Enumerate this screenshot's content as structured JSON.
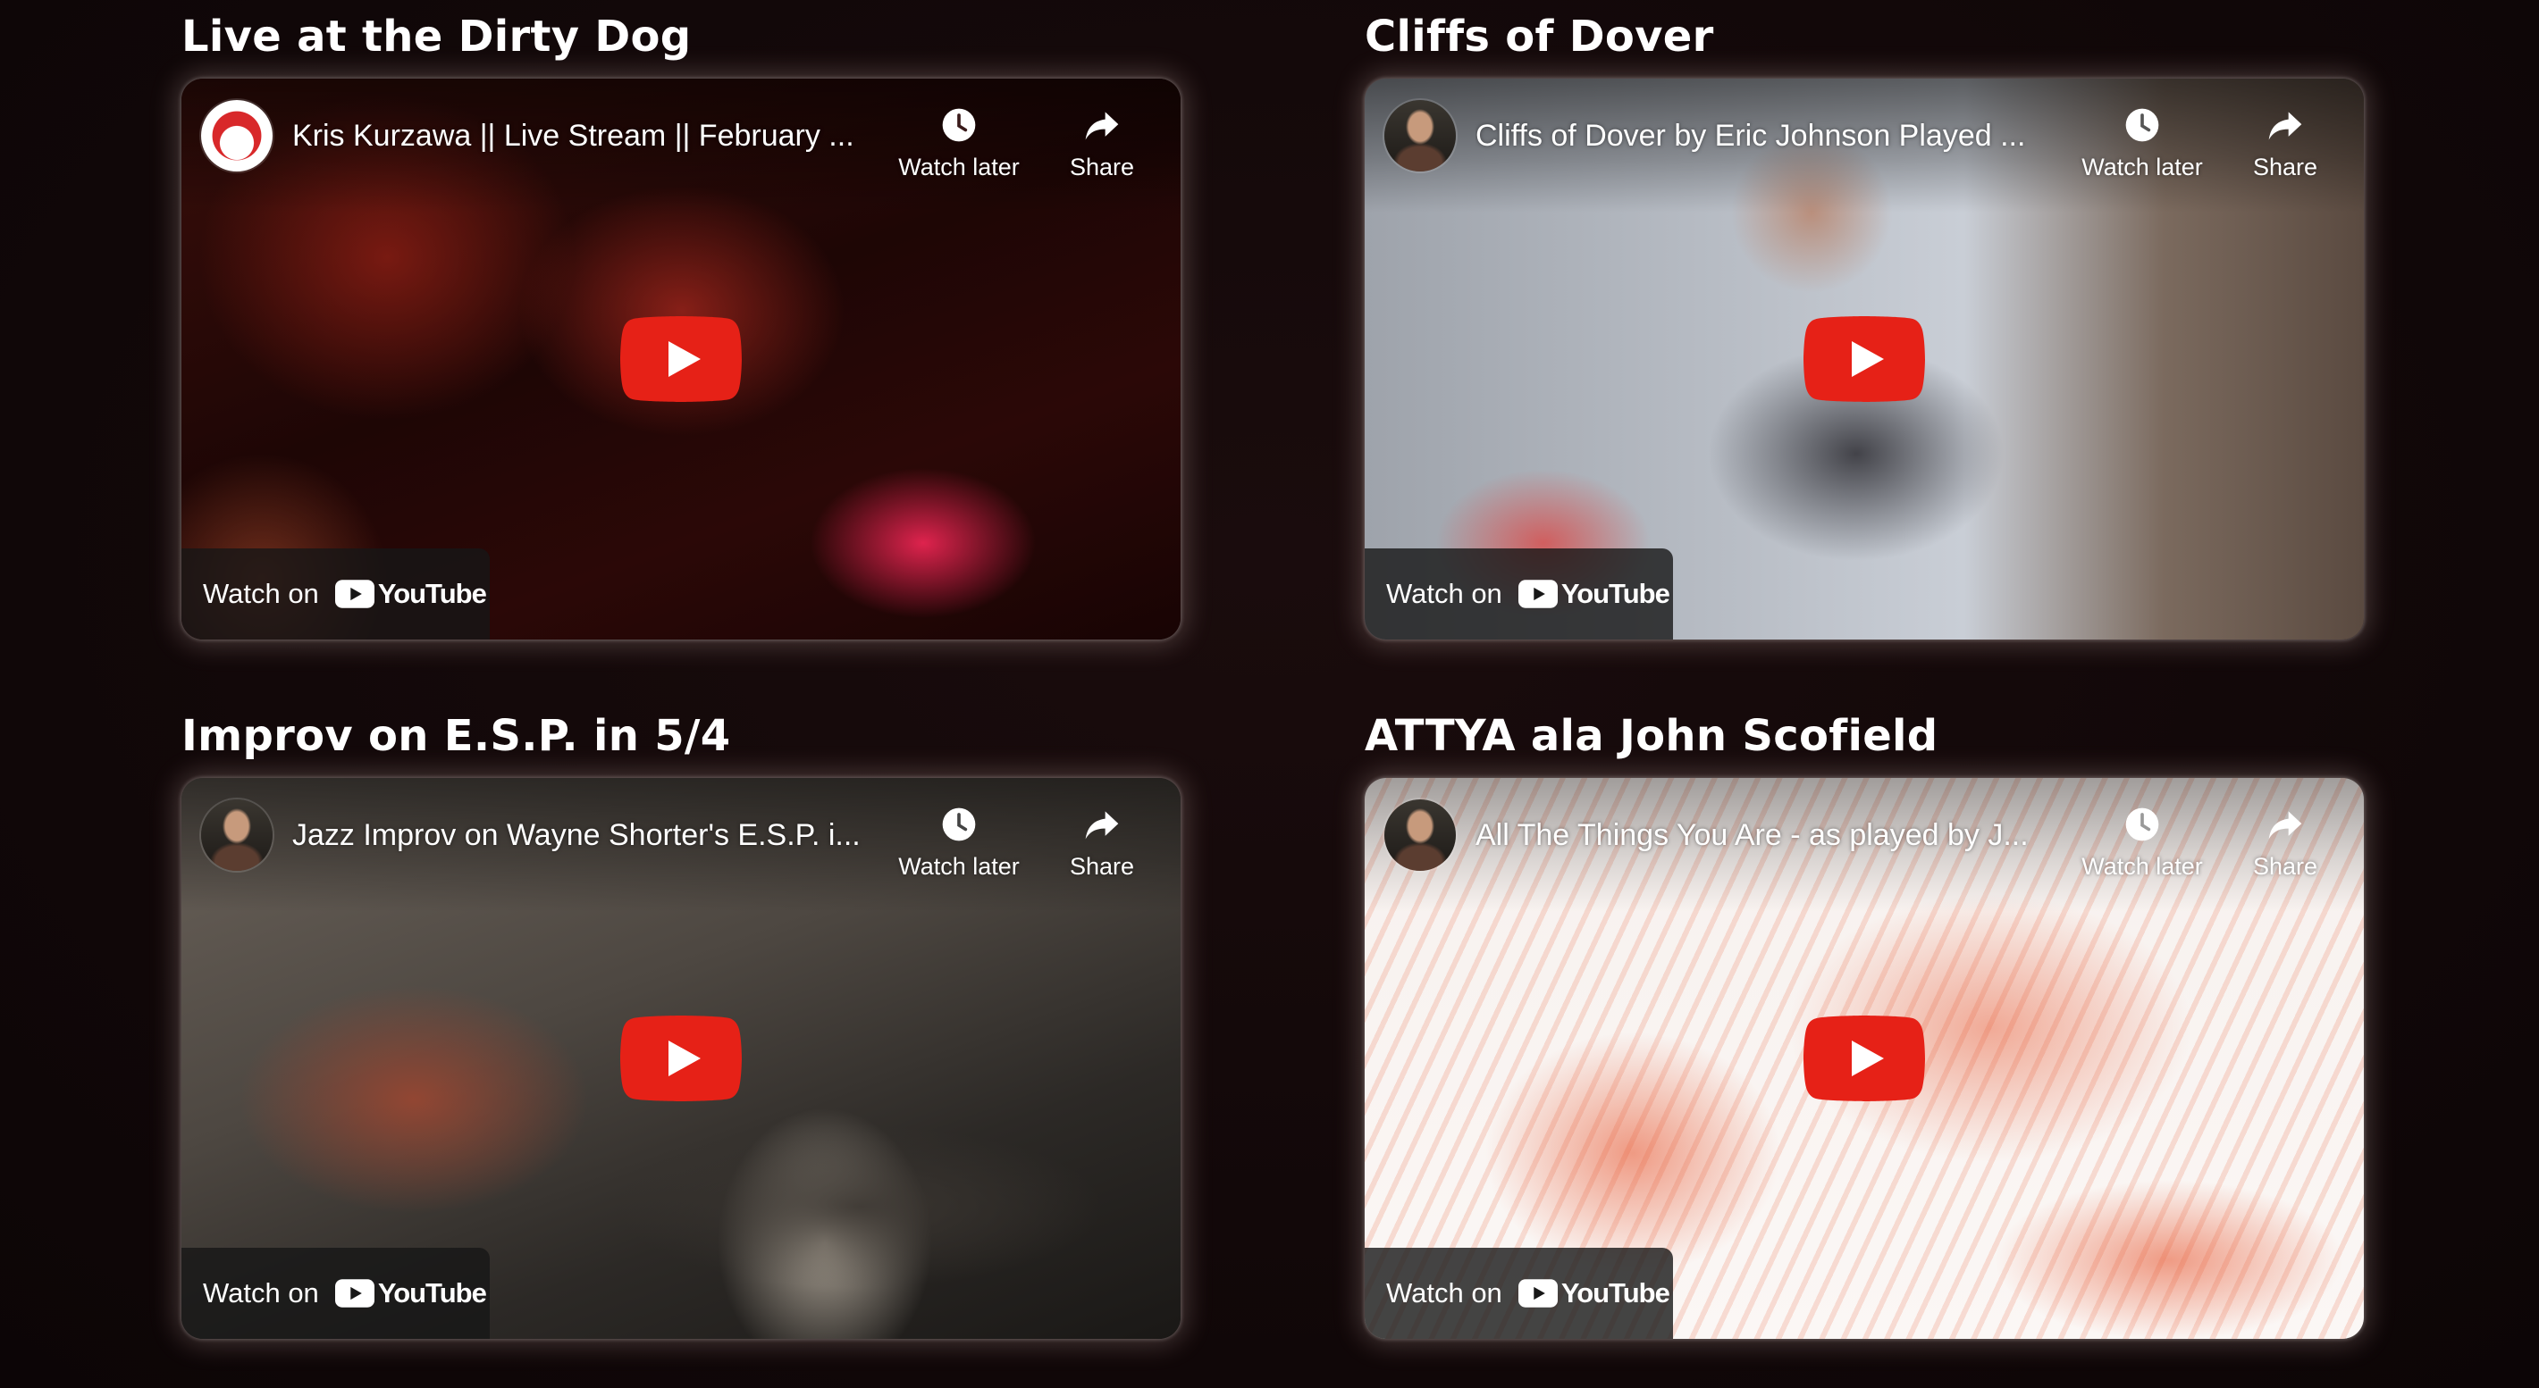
{
  "videos": [
    {
      "section_title": "Live at the Dirty Dog",
      "video_title": "Kris Kurzawa || Live Stream || February ...",
      "watch_later_label": "Watch later",
      "share_label": "Share",
      "watch_on_label": "Watch on",
      "youtube_label": "YouTube",
      "avatar": "dirty-dog-jazz-logo"
    },
    {
      "section_title": "Cliffs of Dover",
      "video_title": "Cliffs of Dover by Eric Johnson Played ...",
      "watch_later_label": "Watch later",
      "share_label": "Share",
      "watch_on_label": "Watch on",
      "youtube_label": "YouTube",
      "avatar": "channel-avatar-guitarist"
    },
    {
      "section_title": "Improv on E.S.P. in 5/4",
      "video_title": "Jazz Improv on Wayne Shorter's E.S.P. i...",
      "watch_later_label": "Watch later",
      "share_label": "Share",
      "watch_on_label": "Watch on",
      "youtube_label": "YouTube",
      "avatar": "channel-avatar-guitarist"
    },
    {
      "section_title": "ATTYA ala John Scofield",
      "video_title": "All The Things You Are - as played by J...",
      "watch_later_label": "Watch later",
      "share_label": "Share",
      "watch_on_label": "Watch on",
      "youtube_label": "YouTube",
      "avatar": "channel-avatar-guitarist"
    }
  ],
  "colors": {
    "page_background": "#120809",
    "youtube_red": "#ff0000",
    "play_button_red": "#e62117",
    "text": "#ffffff"
  },
  "icons": [
    "clock-icon",
    "share-arrow-icon",
    "play-icon",
    "youtube-logo-icon"
  ]
}
